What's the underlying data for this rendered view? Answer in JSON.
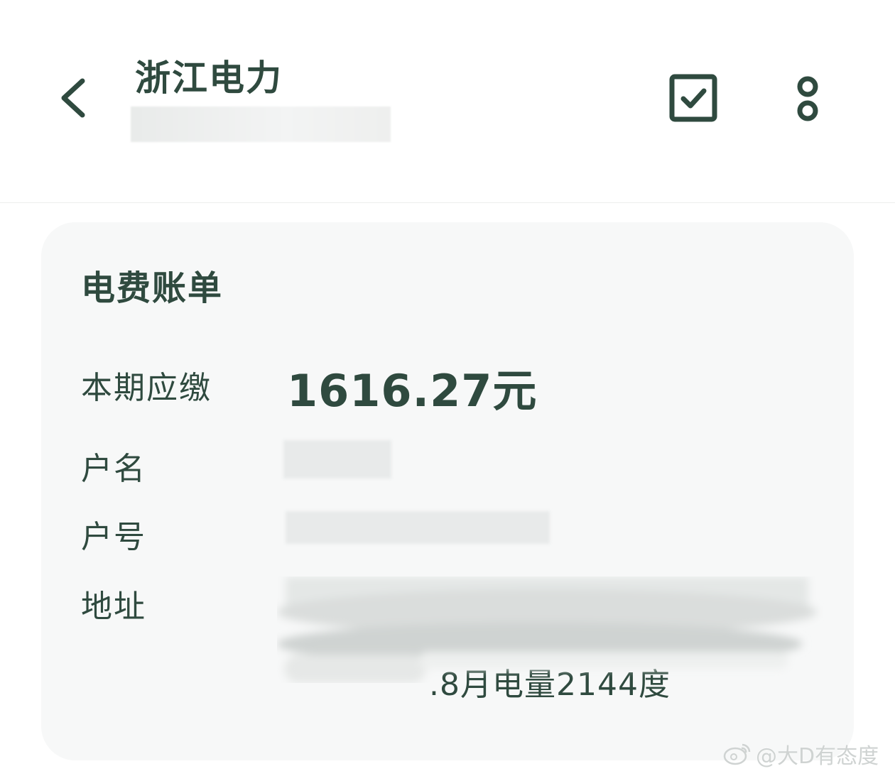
{
  "header": {
    "title": "浙江电力",
    "back_icon": "chevron-left-icon",
    "check_icon": "checkbox-icon",
    "more_icon": "more-vertical-icon"
  },
  "bill": {
    "title": "电费账单",
    "amount_label": "本期应缴",
    "amount_value": "1616.27元",
    "name_label": "户名",
    "account_label": "户号",
    "address_label": "地址",
    "usage_text": ".8月电量2144度"
  },
  "watermark": {
    "text": "@大D有态度",
    "icon": "weibo-icon"
  },
  "colors": {
    "text": "#2f4a3f",
    "card_bg": "#f7f8f8",
    "page_bg": "#ffffff"
  }
}
